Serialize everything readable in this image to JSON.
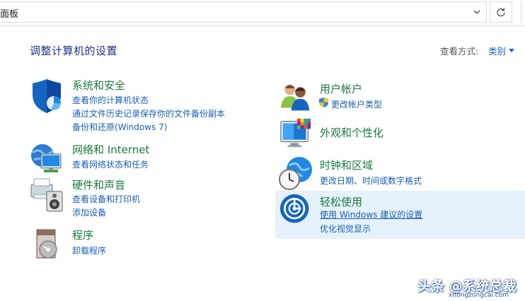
{
  "address_bar": {
    "path_text": "面板",
    "dropdown_icon": "chevron-down-icon",
    "refresh_icon": "refresh-icon"
  },
  "header": {
    "title": "调整计算机的设置",
    "view_by_label": "查看方式:",
    "view_by_value": "类别"
  },
  "categories_left": [
    {
      "title": "系统和安全",
      "icon": "shield-icon",
      "links": [
        "查看你的计算机状态",
        "通过文件历史记录保存你的文件备份副本",
        "备份和还原(Windows 7)"
      ]
    },
    {
      "title": "网络和 Internet",
      "icon": "network-globe-icon",
      "links": [
        "查看网络状态和任务"
      ]
    },
    {
      "title": "硬件和声音",
      "icon": "printer-speaker-icon",
      "links": [
        "查看设备和打印机",
        "添加设备"
      ]
    },
    {
      "title": "程序",
      "icon": "programs-disk-icon",
      "links": [
        "卸载程序"
      ]
    }
  ],
  "categories_right": [
    {
      "title": "用户帐户",
      "icon": "users-icon",
      "links": [
        "更改帐户类型"
      ]
    },
    {
      "title": "外观和个性化",
      "icon": "display-palette-icon",
      "links": []
    },
    {
      "title": "时钟和区域",
      "icon": "clock-globe-icon",
      "links": [
        "更改日期、时间或数字格式"
      ]
    },
    {
      "title": "轻松使用",
      "icon": "ease-of-access-icon",
      "links": [
        "使用 Windows 建议的设置",
        "优化视觉显示"
      ]
    }
  ],
  "watermark": {
    "text": "头条 @系统总裁",
    "subtext": "xitongzongcai.com"
  },
  "colors": {
    "category_title": "#1b7a3a",
    "link": "#1a5fb4",
    "page_title": "#1e3287",
    "hover_highlight": "#e5f1fb"
  }
}
